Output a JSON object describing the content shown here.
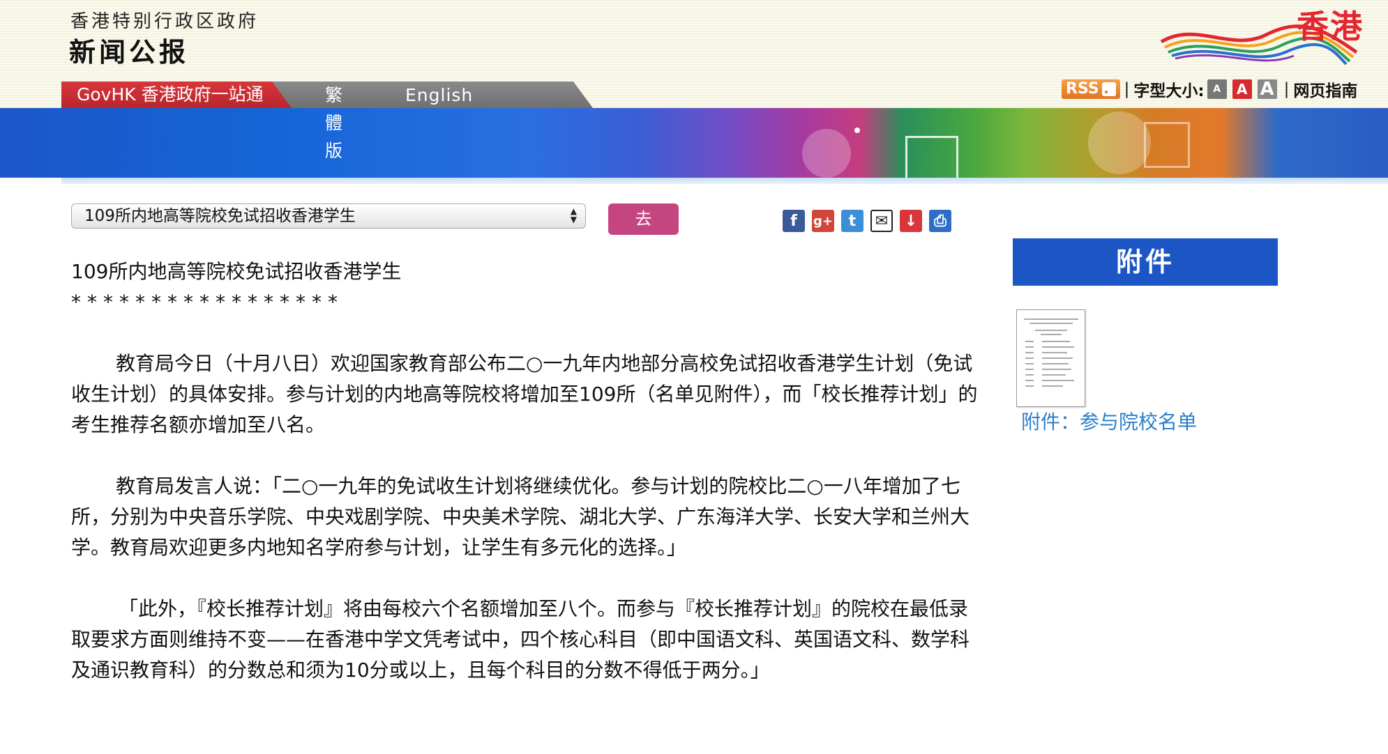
{
  "header": {
    "gov_name": "香港特别行政区政府",
    "press_title": "新闻公报",
    "brand_text": "香港"
  },
  "nav": {
    "govhk": "GovHK 香港政府一站通",
    "traditional": "繁體版",
    "english": "English"
  },
  "tools": {
    "rss": "RSS",
    "font_size_label": "字型大小:",
    "font_small": "A",
    "font_medium": "A",
    "font_large": "A",
    "guide": "网页指南"
  },
  "selector": {
    "selected": "109所内地高等院校免试招收香港学生",
    "go_label": "去"
  },
  "share": {
    "facebook": "f",
    "googleplus": "g+",
    "twitter": "t",
    "email": "✉",
    "bookmark": "↓",
    "print": "⎙"
  },
  "article": {
    "title": "109所内地高等院校免试招收香港学生",
    "stars": "*****************",
    "paragraphs": [
      "教育局今日（十月八日）欢迎国家教育部公布二○一九年内地部分高校免试招收香港学生计划（免试收生计划）的具体安排。参与计划的内地高等院校将增加至109所（名单见附件），而「校长推荐计划」的考生推荐名额亦增加至八名。",
      "教育局发言人说：「二○一九年的免试收生计划将继续优化。参与计划的院校比二○一八年增加了七所，分别为中央音乐学院、中央戏剧学院、中央美术学院、湖北大学、广东海洋大学、长安大学和兰州大学。教育局欢迎更多内地知名学府参与计划，让学生有多元化的选择。」",
      "「此外，『校长推荐计划』将由每校六个名额增加至八个。而参与『校长推荐计划』的院校在最低录取要求方面则维持不变——在香港中学文凭考试中，四个核心科目（即中国语文科、英国语文科、数学科及通识教育科）的分数总和须为10分或以上，且每个科目的分数不得低于两分。」"
    ]
  },
  "attachment": {
    "heading": "附件",
    "link": "附件：参与院校名单"
  },
  "colors": {
    "gov_red": "#c8262c",
    "attach_blue": "#1c55c4",
    "go_button": "#c5457f",
    "link_blue": "#2a7ec8"
  }
}
